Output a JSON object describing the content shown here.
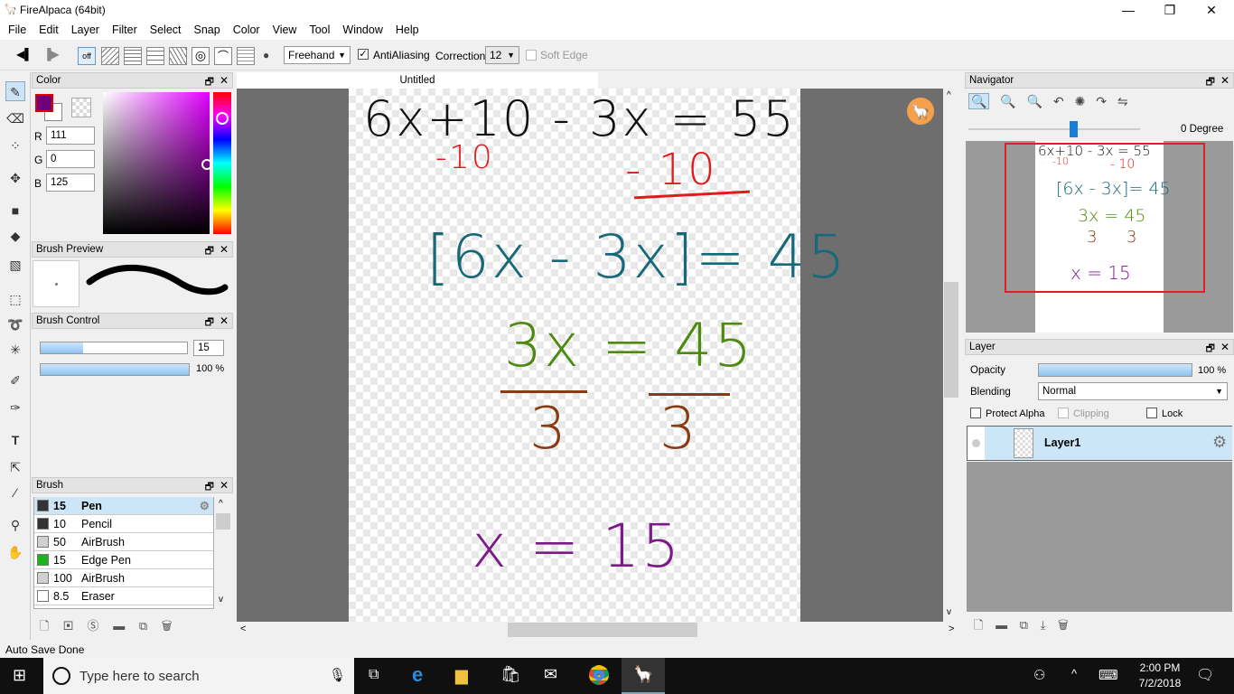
{
  "window": {
    "title": "FireAlpaca (64bit)",
    "minimize": "—",
    "maximize": "❐",
    "close": "✕"
  },
  "menu": [
    "File",
    "Edit",
    "Layer",
    "Filter",
    "Select",
    "Snap",
    "Color",
    "View",
    "Tool",
    "Window",
    "Help"
  ],
  "toolbar": {
    "snap_off": "off",
    "stroke_mode": "Freehand",
    "antialiasing_label": "AntiAliasing",
    "antialiasing_checked": true,
    "correction_label": "Correction",
    "correction_value": "12",
    "soft_edge_label": "Soft Edge"
  },
  "color_panel": {
    "title": "Color",
    "r_label": "R",
    "r": "111",
    "g_label": "G",
    "g": "0",
    "b_label": "B",
    "b": "125",
    "current": "#6f007d"
  },
  "brush_preview": {
    "title": "Brush Preview"
  },
  "brush_control": {
    "title": "Brush Control",
    "size": "15",
    "opacity": "100 %"
  },
  "brush_panel": {
    "title": "Brush",
    "items": [
      {
        "size": "15",
        "name": "Pen",
        "color": "#333333",
        "selected": true
      },
      {
        "size": "10",
        "name": "Pencil",
        "color": "#333333"
      },
      {
        "size": "50",
        "name": "AirBrush",
        "color": "#d0d0d0"
      },
      {
        "size": "15",
        "name": "Edge Pen",
        "color": "#1db31d"
      },
      {
        "size": "100",
        "name": "AirBrush",
        "color": "#d0d0d0"
      },
      {
        "size": "8.5",
        "name": "Eraser",
        "color": "#ffffff"
      }
    ]
  },
  "document": {
    "tab": "Untitled",
    "lines": [
      {
        "text": "6x+10 - 3x = 55",
        "color": "#111111"
      },
      {
        "text": "-10",
        "color": "#e01b1b"
      },
      {
        "text": "- 10",
        "color": "#e01b1b"
      },
      {
        "text": "[6x - 3x]= 45",
        "color": "#17697a"
      },
      {
        "text": "3x = 45",
        "color": "#4f8a10"
      },
      {
        "text": "3",
        "color": "#8a3a10"
      },
      {
        "text": "3",
        "color": "#8a3a10"
      },
      {
        "text": "x = 15",
        "color": "#7d1a8a"
      }
    ]
  },
  "navigator": {
    "title": "Navigator",
    "angle": "0 Degree"
  },
  "layer_panel": {
    "title": "Layer",
    "opacity_label": "Opacity",
    "opacity": "100 %",
    "blending_label": "Blending",
    "blending": "Normal",
    "protect_alpha": "Protect Alpha",
    "clipping": "Clipping",
    "lock": "Lock",
    "layers": [
      {
        "name": "Layer1"
      }
    ]
  },
  "status": "Auto Save Done",
  "taskbar": {
    "search_placeholder": "Type here to search",
    "time": "2:00 PM",
    "date": "7/2/2018"
  }
}
